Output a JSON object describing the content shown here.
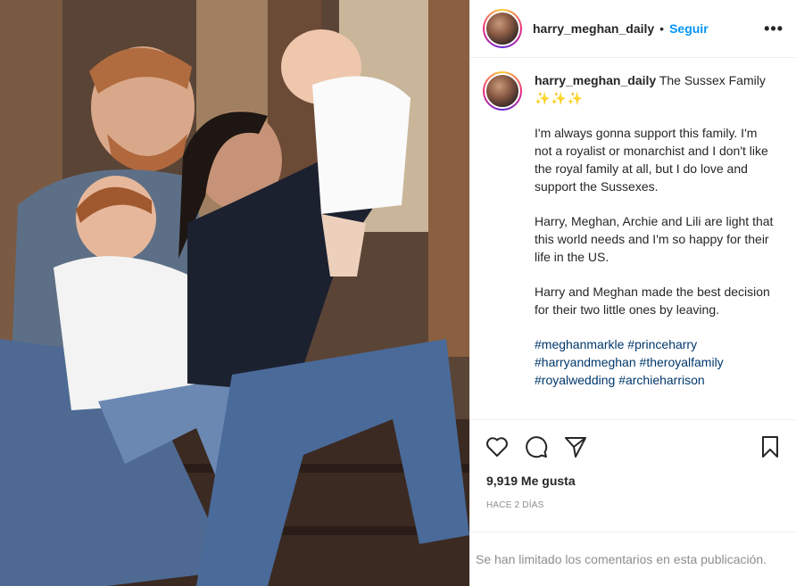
{
  "post": {
    "photo_alt": "Family photo: couple sitting on steps with a toddler and a baby held up"
  },
  "header": {
    "username": "harry_meghan_daily",
    "separator": "•",
    "follow_label": "Seguir",
    "more_label": "•••"
  },
  "caption": {
    "username": "harry_meghan_daily",
    "title": "The Sussex Family",
    "sparkles": "✨✨✨",
    "paragraphs": [
      "I'm always gonna support this family. I'm not a royalist or monarchist and I don't like the royal family at all, but I do love and support the Sussexes.",
      "Harry, Meghan, Archie and Lili are light that this world needs and I'm so happy for their life in the US.",
      "Harry and Meghan made the best decision for their two little ones by leaving."
    ],
    "hashtags": [
      "#meghanmarkle",
      "#princeharry",
      "#harryandmeghan",
      "#theroyalfamily",
      "#royalwedding",
      "#archieharrison"
    ]
  },
  "actions": {
    "like_icon": "heart-icon",
    "comment_icon": "comment-icon",
    "share_icon": "paper-plane-icon",
    "save_icon": "bookmark-icon"
  },
  "stats": {
    "likes": "9,919 Me gusta",
    "time_ago": "HACE 2 DÍAS"
  },
  "comments": {
    "limited_notice": "Se han limitado los comentarios en esta publicación."
  },
  "colors": {
    "follow_blue": "#0095f6",
    "hashtag_blue": "#00376b",
    "secondary_text": "#8e8e8e"
  }
}
